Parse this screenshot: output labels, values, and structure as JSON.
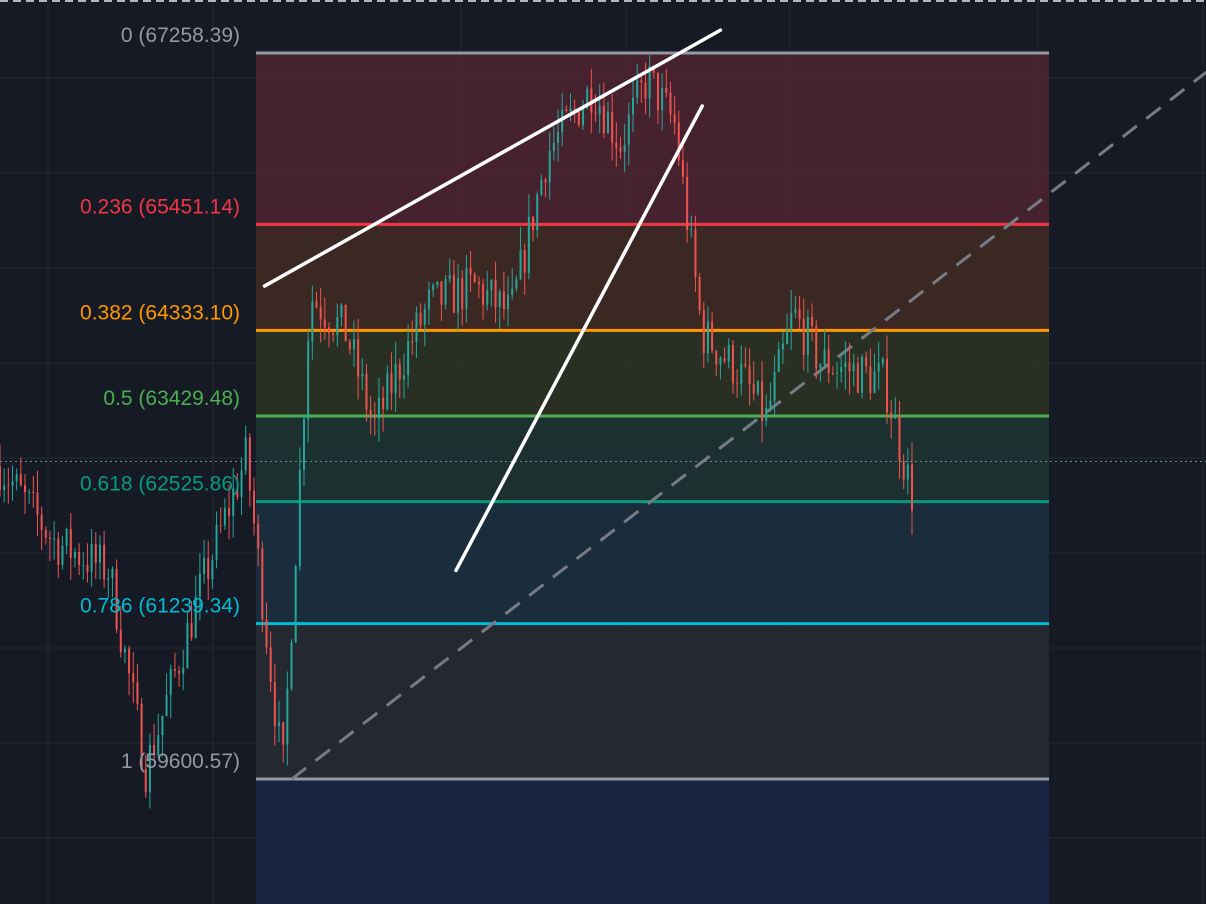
{
  "chart_data": {
    "type": "candlestick",
    "title": "",
    "xlabel": "",
    "ylabel": "",
    "ylim": [
      58300,
      67500
    ],
    "grid": true,
    "colors": {
      "background": "#161a25",
      "grid": "#232836",
      "up": "#26a69a",
      "down": "#ef5350",
      "trendline": "#ffffff",
      "diagonal": "#787b86"
    },
    "candles": {
      "description": "approximate price path read from the chart",
      "path": [
        {
          "t": 0,
          "v": 62900
        },
        {
          "t": 0.06,
          "v": 62100
        },
        {
          "t": 0.12,
          "v": 61800
        },
        {
          "t": 0.16,
          "v": 59700
        },
        {
          "t": 0.22,
          "v": 61600
        },
        {
          "t": 0.27,
          "v": 63000
        },
        {
          "t": 0.31,
          "v": 59650
        },
        {
          "t": 0.34,
          "v": 64700
        },
        {
          "t": 0.38,
          "v": 64300
        },
        {
          "t": 0.41,
          "v": 63300
        },
        {
          "t": 0.44,
          "v": 64000
        },
        {
          "t": 0.47,
          "v": 64600
        },
        {
          "t": 0.52,
          "v": 64800
        },
        {
          "t": 0.56,
          "v": 64500
        },
        {
          "t": 0.6,
          "v": 66200
        },
        {
          "t": 0.65,
          "v": 66900
        },
        {
          "t": 0.68,
          "v": 66300
        },
        {
          "t": 0.71,
          "v": 67000
        },
        {
          "t": 0.74,
          "v": 66500
        },
        {
          "t": 0.77,
          "v": 64300
        },
        {
          "t": 0.81,
          "v": 63900
        },
        {
          "t": 0.84,
          "v": 63400
        },
        {
          "t": 0.87,
          "v": 64500
        },
        {
          "t": 0.9,
          "v": 64000
        },
        {
          "t": 0.94,
          "v": 63900
        },
        {
          "t": 0.97,
          "v": 63800
        },
        {
          "t": 1,
          "v": 62600
        }
      ]
    },
    "fibonacci": {
      "high": 67258.39,
      "low": 59600.57,
      "levels": [
        {
          "ratio": 0,
          "value": 67258.39,
          "label": "0 (67258.39)",
          "color": "#9598a1",
          "fill": "#4a2430"
        },
        {
          "ratio": 0.236,
          "value": 65451.14,
          "label": "0.236 (65451.14)",
          "color": "#f23645",
          "fill": "#3f2a24"
        },
        {
          "ratio": 0.382,
          "value": 64333.1,
          "label": "0.382 (64333.10)",
          "color": "#ff9800",
          "fill": "#2b3324"
        },
        {
          "ratio": 0.5,
          "value": 63429.48,
          "label": "0.5 (63429.48)",
          "color": "#4caf50",
          "fill": "#1d3431"
        },
        {
          "ratio": 0.618,
          "value": 62525.86,
          "label": "0.618 (62525.86)",
          "color": "#089981",
          "fill": "#1a3040"
        },
        {
          "ratio": 0.786,
          "value": 61239.34,
          "label": "0.786 (61239.34)",
          "color": "#00bcd4",
          "fill": "#262a33"
        },
        {
          "ratio": 1,
          "value": 59600.57,
          "label": "1 (59600.57)",
          "color": "#9598a1",
          "fill": "#1b2545"
        }
      ]
    },
    "current_price": 62950,
    "annotations": [
      {
        "type": "trendline",
        "from": {
          "t": 0.29,
          "v": 64800
        },
        "to": {
          "t": 0.79,
          "v": 67500
        }
      },
      {
        "type": "trendline",
        "from": {
          "t": 0.5,
          "v": 61800
        },
        "to": {
          "t": 0.77,
          "v": 66700
        }
      },
      {
        "type": "diagonal-dashed",
        "from": {
          "t": 0.32,
          "v": 59600.57
        },
        "to": {
          "t": 1.35,
          "v": 67258.39
        }
      }
    ]
  }
}
